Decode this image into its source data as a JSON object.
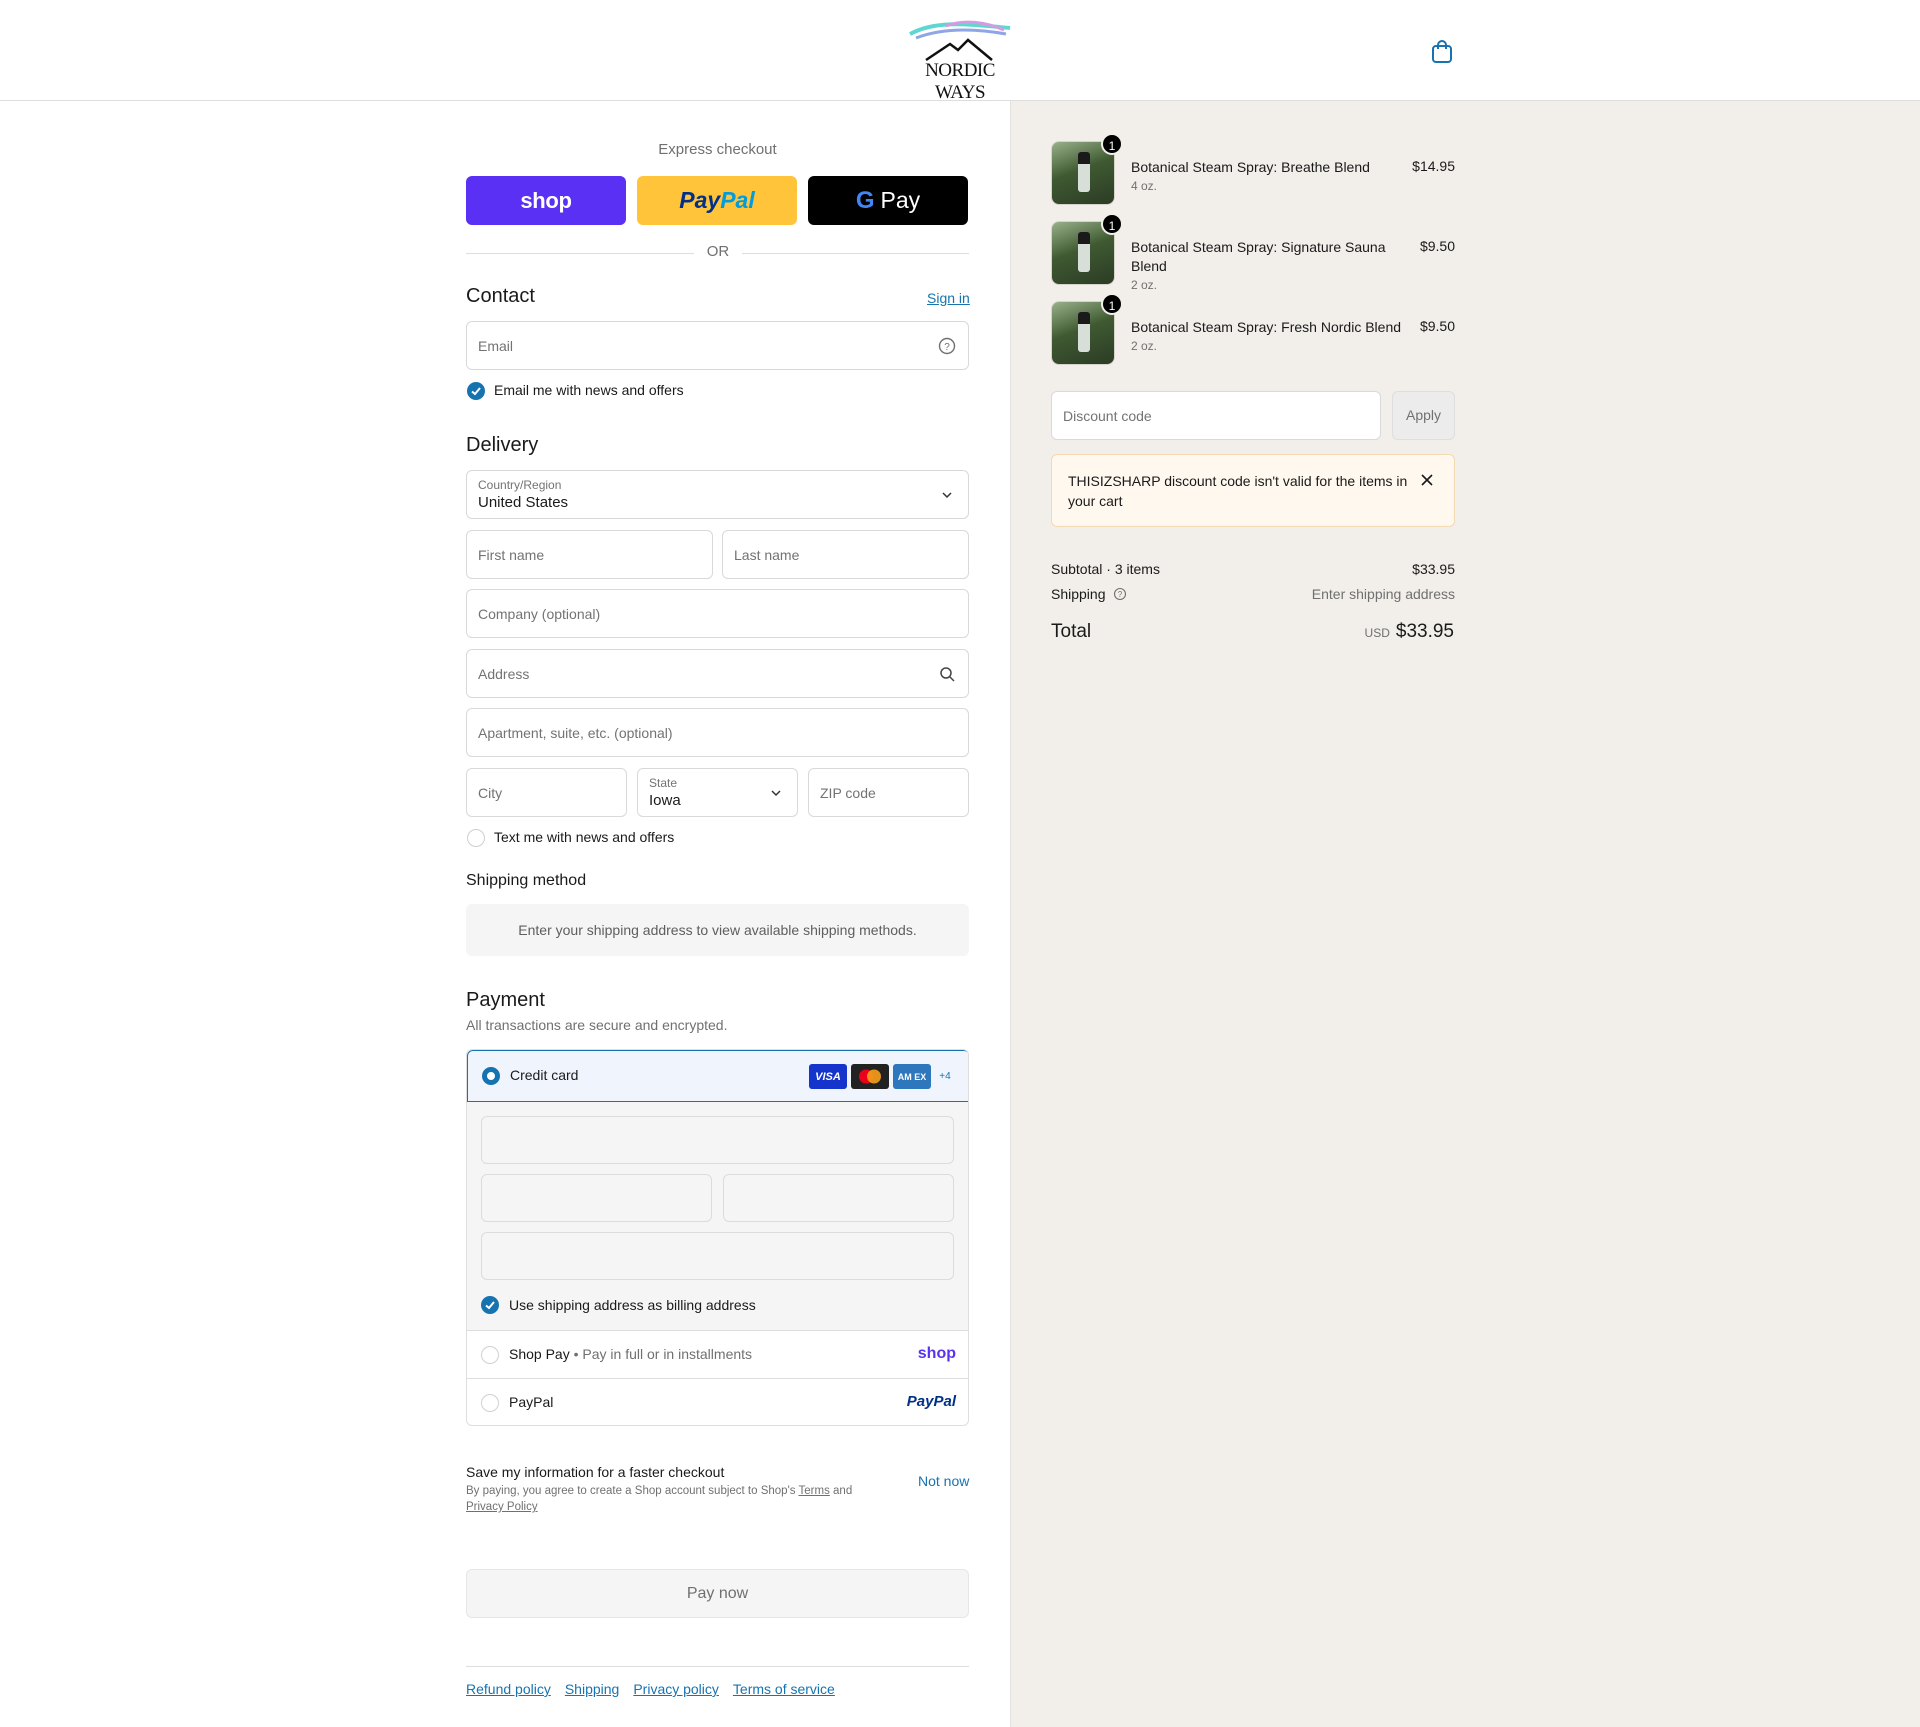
{
  "header": {
    "logo_text": "NORDIC WAYS",
    "colors": {
      "accent": "#1773b0",
      "shop": "#5a31f4",
      "paypal": "#ffc439"
    }
  },
  "express": {
    "title": "Express checkout",
    "shop_label": "shop",
    "paypal_label_a": "Pay",
    "paypal_label_b": "Pal",
    "gpay_label": "Pay",
    "or": "OR"
  },
  "contact": {
    "title": "Contact",
    "sign_in": "Sign in",
    "email_placeholder": "Email",
    "news_label": "Email me with news and offers",
    "news_checked": true
  },
  "delivery": {
    "title": "Delivery",
    "country_label": "Country/Region",
    "country_value": "United States",
    "first_name": "First name",
    "last_name": "Last name",
    "company": "Company (optional)",
    "address": "Address",
    "apartment": "Apartment, suite, etc. (optional)",
    "city": "City",
    "state_label": "State",
    "state_value": "Iowa",
    "zip": "ZIP code",
    "text_label": "Text me with news and offers",
    "text_checked": false
  },
  "shipping_method": {
    "title": "Shipping method",
    "message": "Enter your shipping address to view available shipping methods."
  },
  "payment": {
    "title": "Payment",
    "subtitle": "All transactions are secure and encrypted.",
    "credit_card": "Credit card",
    "card_brands": [
      "VISA",
      "",
      "AM EX",
      "+4"
    ],
    "billing_label": "Use shipping address as billing address",
    "shop_pay": "Shop Pay",
    "shop_pay_sub": " • Pay in full or in installments",
    "shop_logo": "shop",
    "paypal": "PayPal",
    "paypal_logo": "PayPal"
  },
  "save_info": {
    "title": "Save my information for a faster checkout",
    "text_a": "By paying, you agree to create a Shop account subject to Shop's ",
    "terms": "Terms",
    "text_b": " and ",
    "privacy": "Privacy Policy",
    "not_now": "Not now"
  },
  "pay_now": "Pay now",
  "footer_links": [
    "Refund policy",
    "Shipping",
    "Privacy policy",
    "Terms of service"
  ],
  "summary": {
    "items": [
      {
        "qty": "1",
        "name": "Botanical Steam Spray: Breathe Blend",
        "variant": "4 oz.",
        "price": "$14.95"
      },
      {
        "qty": "1",
        "name": "Botanical Steam Spray: Signature Sauna Blend",
        "variant": "2 oz.",
        "price": "$9.50"
      },
      {
        "qty": "1",
        "name": "Botanical Steam Spray: Fresh Nordic Blend",
        "variant": "2 oz.",
        "price": "$9.50"
      }
    ],
    "discount_placeholder": "Discount code",
    "apply": "Apply",
    "warning": "THISIZSHARP discount code isn't valid for the items in your cart",
    "subtotal_label": "Subtotal · 3 items",
    "subtotal_value": "$33.95",
    "shipping_label": "Shipping",
    "shipping_value": "Enter shipping address",
    "total_label": "Total",
    "currency": "USD",
    "total_value": "$33.95"
  }
}
